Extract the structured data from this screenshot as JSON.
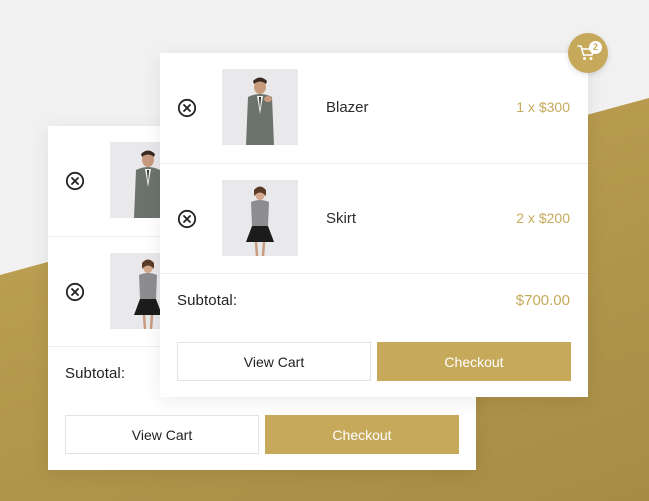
{
  "colors": {
    "accent": "#c6a95a",
    "background": "#f1f1f1",
    "card": "#ffffff",
    "text": "#222222"
  },
  "cart": {
    "icon": "shopping-cart-icon",
    "count": "2"
  },
  "items": [
    {
      "name": "Blazer",
      "price": "1 x $300",
      "image": "man-in-grey-suit"
    },
    {
      "name": "Skirt",
      "price": "2 x $200",
      "image": "woman-in-black-skirt"
    }
  ],
  "subtotal": {
    "label": "Subtotal:",
    "value": "$700.00"
  },
  "buttons": {
    "view_cart": "View Cart",
    "checkout": "Checkout"
  }
}
